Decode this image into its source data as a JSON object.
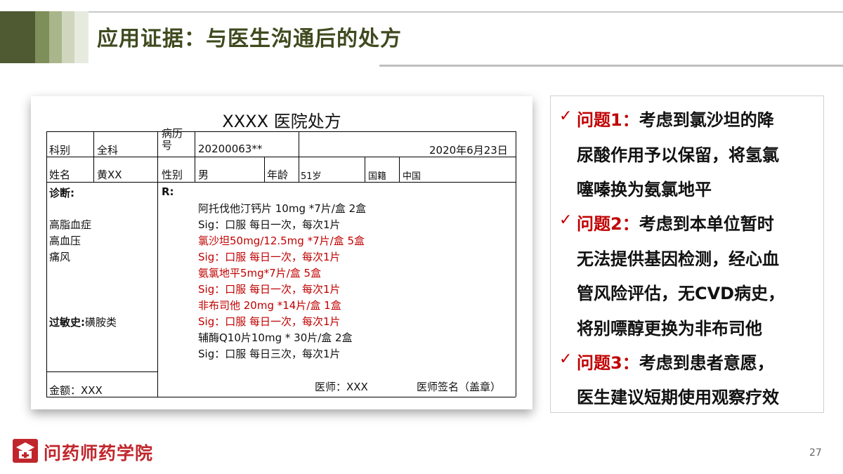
{
  "slide": {
    "title": "应用证据：与医生沟通后的处方",
    "page_number": "27",
    "logo_text": "问药师药学院",
    "accent_color": "#c00000",
    "title_color": "#3f4a1f"
  },
  "prescription": {
    "title": "XXXX 医院处方",
    "dept_label": "科别",
    "dept_value": "全科",
    "record_label_1": "病历",
    "record_label_2": "号",
    "record_value": "20200063**",
    "date": "2020年6月23日",
    "name_label": "姓名",
    "name_value": "黄XX",
    "sex_label": "性别",
    "sex_value": "男",
    "age_label": "年龄",
    "age_value": "51岁",
    "nation_label": "国籍",
    "nation_value": "中国",
    "diagnosis_label": "诊断:",
    "diagnoses": [
      "高脂血症",
      "高血压",
      "痛风"
    ],
    "allergy_label": "过敏史:",
    "allergy_value": "磺胺类",
    "rx_label": "R:",
    "lines": [
      {
        "text": "阿托伐他汀钙片 10mg *7片/盒   2盒",
        "red": false
      },
      {
        "text": "Sig：口服 每日一次，每次1片",
        "red": false
      },
      {
        "text": "氯沙坦50mg/12.5mg *7片/盒   5盒",
        "red": true
      },
      {
        "text": "Sig：口服 每日一次，每次1片",
        "red": true
      },
      {
        "text": "氨氯地平5mg*7片/盒   5盒",
        "red": true
      },
      {
        "text": "Sig：口服 每日一次，每次1片",
        "red": true
      },
      {
        "text": "非布司他  20mg *14片/盒   1盒",
        "red": true
      },
      {
        "text": "Sig：口服 每日一次，每次1片",
        "red": true
      },
      {
        "text": "辅酶Q10片10mg * 30片/盒   2盒",
        "red": false
      },
      {
        "text": "Sig：口服 每日三次，每次1片",
        "red": false
      }
    ],
    "amount": "金额：XXX",
    "doctor": "医师：XXX",
    "signature": "医师签名（盖章）"
  },
  "notes": [
    {
      "check": "✓",
      "label": "问题1：",
      "lines": [
        "考虑到氯沙坦的降",
        "尿酸作用予以保留，将氢氯",
        "噻嗪换为氨氯地平"
      ]
    },
    {
      "check": "✓",
      "label": "问题2：",
      "lines": [
        "考虑到本单位暂时",
        "无法提供基因检测，经心血",
        "管风险评估，无CVD病史，",
        "将别嘌醇更换为非布司他"
      ]
    },
    {
      "check": "✓",
      "label": "问题3：",
      "lines": [
        "考虑到患者意愿，",
        "医生建议短期使用观察疗效"
      ]
    }
  ]
}
